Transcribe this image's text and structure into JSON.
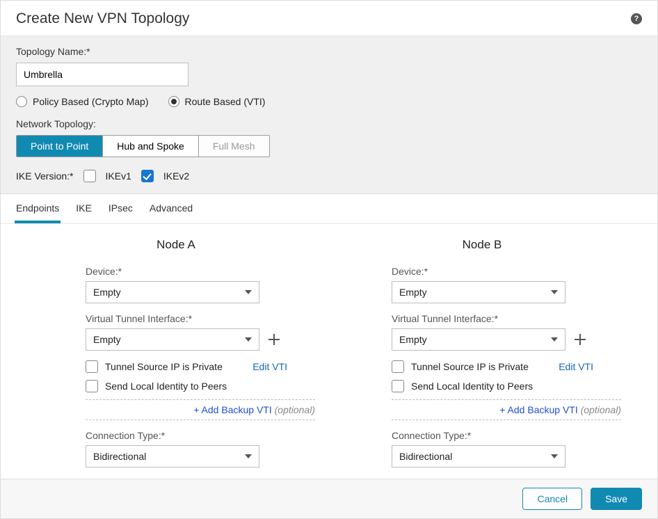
{
  "dialog": {
    "title": "Create New VPN Topology"
  },
  "form": {
    "topology_name_label": "Topology Name:*",
    "topology_name_value": "Umbrella",
    "vpn_type": {
      "policy_label": "Policy Based (Crypto Map)",
      "route_label": "Route Based (VTI)",
      "selected": "route"
    },
    "network_topology_label": "Network Topology:",
    "network_topology": {
      "p2p": "Point to Point",
      "hub": "Hub and Spoke",
      "mesh": "Full Mesh",
      "selected": "p2p"
    },
    "ike_version_label": "IKE Version:*",
    "ike": {
      "v1_label": "IKEv1",
      "v1_checked": false,
      "v2_label": "IKEv2",
      "v2_checked": true
    }
  },
  "tabs": {
    "endpoints": "Endpoints",
    "ike": "IKE",
    "ipsec": "IPsec",
    "advanced": "Advanced",
    "active": "endpoints"
  },
  "nodes": {
    "a": {
      "title": "Node A",
      "device_label": "Device:*",
      "device_value": "Empty",
      "vti_label": "Virtual Tunnel Interface:*",
      "vti_value": "Empty",
      "tunnel_private_label": "Tunnel Source IP is Private",
      "edit_vti": "Edit VTI",
      "send_local_label": "Send Local Identity to Peers",
      "add_backup_label": "+ Add Backup VTI",
      "add_backup_optional": "(optional)",
      "conn_type_label": "Connection Type:*",
      "conn_type_value": "Bidirectional"
    },
    "b": {
      "title": "Node B",
      "device_label": "Device:*",
      "device_value": "Empty",
      "vti_label": "Virtual Tunnel Interface:*",
      "vti_value": "Empty",
      "tunnel_private_label": "Tunnel Source IP is Private",
      "edit_vti": "Edit VTI",
      "send_local_label": "Send Local Identity to Peers",
      "add_backup_label": "+ Add Backup VTI",
      "add_backup_optional": "(optional)",
      "conn_type_label": "Connection Type:*",
      "conn_type_value": "Bidirectional"
    }
  },
  "footer": {
    "cancel": "Cancel",
    "save": "Save"
  }
}
